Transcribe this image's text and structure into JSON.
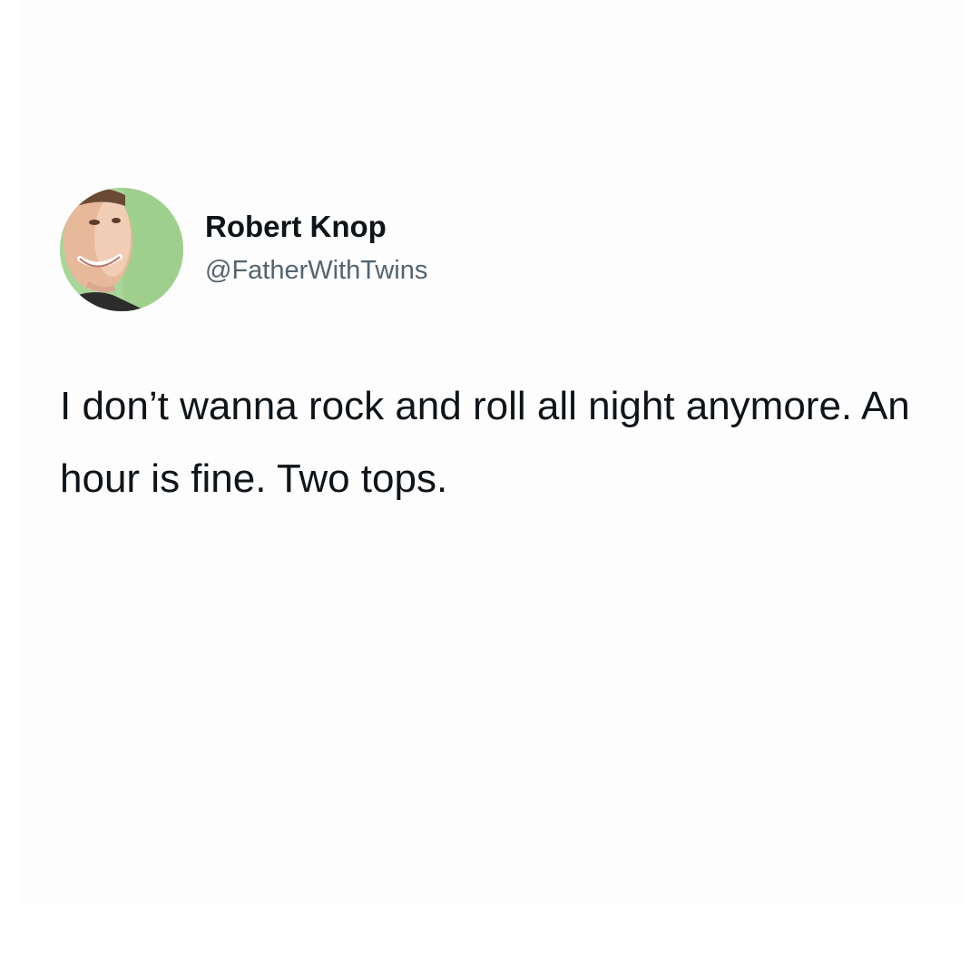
{
  "tweet": {
    "author_name": "Robert Knop",
    "author_handle": "@FatherWithTwins",
    "avatar": "profile-photo-icon",
    "text": "I don’t wanna rock and roll all night anymore. An hour is fine. Two tops."
  }
}
